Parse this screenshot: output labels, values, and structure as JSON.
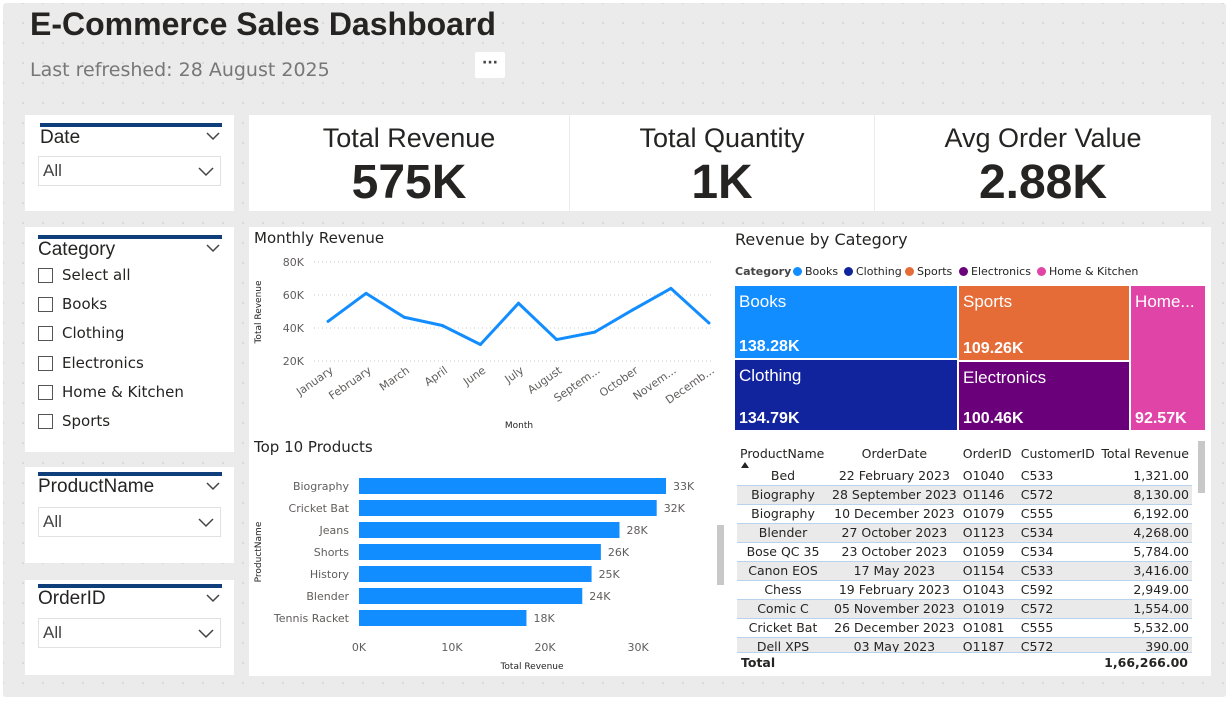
{
  "header": {
    "title": "E-Commerce Sales Dashboard",
    "subtitle": "Last refreshed: 28 August 2025",
    "more_label": "···"
  },
  "slicers": {
    "date": {
      "title": "Date",
      "value": "All"
    },
    "category": {
      "title": "Category",
      "options": [
        "Select all",
        "Books",
        "Clothing",
        "Electronics",
        "Home & Kitchen",
        "Sports"
      ]
    },
    "product": {
      "title": "ProductName",
      "value": "All"
    },
    "order": {
      "title": "OrderID",
      "value": "All"
    }
  },
  "kpis": [
    {
      "label": "Total Revenue",
      "value": "575K"
    },
    {
      "label": "Total Quantity",
      "value": "1K"
    },
    {
      "label": "Avg Order Value",
      "value": "2.88K"
    }
  ],
  "chart_data": [
    {
      "type": "line",
      "title": "Monthly Revenue",
      "xlabel": "Month",
      "ylabel": "Total Revenue",
      "categories": [
        "January",
        "February",
        "March",
        "April",
        "June",
        "July",
        "August",
        "Septem...",
        "October",
        "Novem...",
        "Decemb..."
      ],
      "values": [
        44000,
        61000,
        46500,
        41500,
        30000,
        55000,
        33000,
        37500,
        51000,
        64000,
        43000
      ],
      "yticks": [
        "20K",
        "40K",
        "60K",
        "80K"
      ],
      "ylim": [
        20000,
        80000
      ],
      "color": "#118dff",
      "grid": true
    },
    {
      "type": "bar",
      "orientation": "horizontal",
      "title": "Top 10 Products",
      "xlabel": "Total Revenue",
      "ylabel": "ProductName",
      "categories": [
        "Biography",
        "Cricket Bat",
        "Jeans",
        "Shorts",
        "History",
        "Blender",
        "Tennis Racket"
      ],
      "values": [
        33000,
        32000,
        28000,
        26000,
        25000,
        24000,
        18000
      ],
      "labels": [
        "33K",
        "32K",
        "28K",
        "26K",
        "25K",
        "24K",
        "18K"
      ],
      "xticks": [
        "0K",
        "10K",
        "20K",
        "30K"
      ],
      "xlim": [
        0,
        33000
      ],
      "color": "#118dff"
    },
    {
      "type": "treemap",
      "title": "Revenue by Category",
      "legend_title": "Category",
      "categories": [
        "Books",
        "Clothing",
        "Sports",
        "Electronics",
        "Home & Kitchen"
      ],
      "values": [
        138.28,
        134.79,
        109.26,
        100.46,
        92.57
      ],
      "labels": [
        "138.28K",
        "134.79K",
        "109.26K",
        "100.46K",
        "92.57K"
      ],
      "tile_labels": [
        "Books",
        "Clothing",
        "Sports",
        "Electronics",
        "Home..."
      ],
      "colors": [
        "#118dff",
        "#12239e",
        "#e66c37",
        "#6b007b",
        "#e044a7"
      ]
    }
  ],
  "table": {
    "columns": [
      "ProductName",
      "OrderDate",
      "OrderID",
      "CustomerID",
      "Total Revenue"
    ],
    "rows": [
      [
        "Bed",
        "22 February 2023",
        "O1040",
        "C533",
        "1,321.00"
      ],
      [
        "Biography",
        "28 September 2023",
        "O1146",
        "C572",
        "8,130.00"
      ],
      [
        "Biography",
        "10 December 2023",
        "O1079",
        "C555",
        "6,192.00"
      ],
      [
        "Blender",
        "27 October 2023",
        "O1123",
        "C534",
        "4,268.00"
      ],
      [
        "Bose QC 35",
        "23 October 2023",
        "O1059",
        "C534",
        "5,784.00"
      ],
      [
        "Canon EOS",
        "17 May 2023",
        "O1154",
        "C533",
        "3,416.00"
      ],
      [
        "Chess",
        "19 February 2023",
        "O1043",
        "C592",
        "2,949.00"
      ],
      [
        "Comic C",
        "05 November 2023",
        "O1019",
        "C572",
        "1,554.00"
      ],
      [
        "Cricket Bat",
        "26 December 2023",
        "O1081",
        "C555",
        "5,532.00"
      ],
      [
        "Dell XPS",
        "03 May 2023",
        "O1187",
        "C572",
        "390.00"
      ]
    ],
    "total_label": "Total",
    "total_value": "1,66,266.00"
  }
}
